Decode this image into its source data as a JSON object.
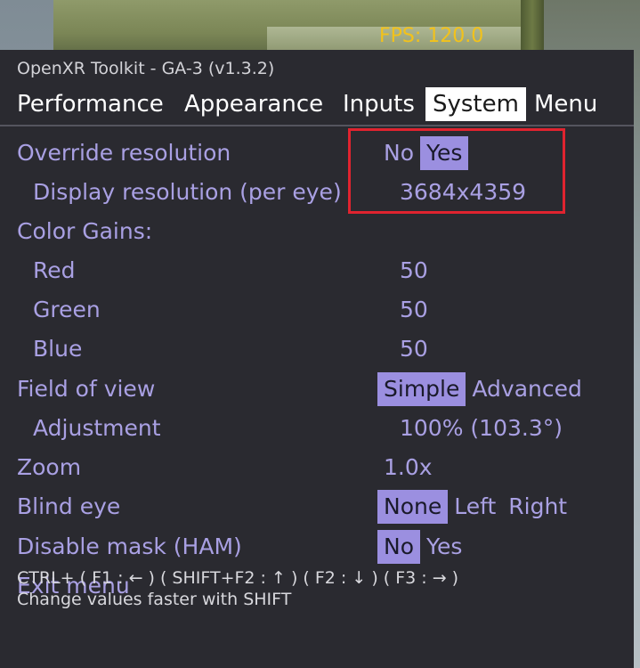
{
  "fps": "FPS: 120.0",
  "panel": {
    "title": "OpenXR Toolkit - GA-3 (v1.3.2)",
    "tabs": [
      "Performance",
      "Appearance",
      "Inputs",
      "System",
      "Menu"
    ],
    "active_tab": "System"
  },
  "settings": {
    "override_resolution": {
      "label": "Override resolution",
      "options": [
        "No",
        "Yes"
      ],
      "selected": "Yes"
    },
    "display_resolution": {
      "label": "Display resolution (per eye)",
      "value": "3684x4359"
    },
    "color_gains": {
      "label": "Color Gains:"
    },
    "red": {
      "label": "Red",
      "value": "50"
    },
    "green": {
      "label": "Green",
      "value": "50"
    },
    "blue": {
      "label": "Blue",
      "value": "50"
    },
    "field_of_view": {
      "label": "Field of view",
      "options": [
        "Simple",
        "Advanced"
      ],
      "selected": "Simple"
    },
    "adjustment": {
      "label": "Adjustment",
      "value": "100% (103.3°)"
    },
    "zoom": {
      "label": "Zoom",
      "value": "1.0x"
    },
    "blind_eye": {
      "label": "Blind eye",
      "options": [
        "None",
        "Left",
        "Right"
      ],
      "selected": "None"
    },
    "disable_mask": {
      "label": "Disable mask (HAM)",
      "options": [
        "No",
        "Yes"
      ],
      "selected": "No"
    },
    "exit_menu": {
      "label": "Exit menu"
    }
  },
  "help": {
    "line1": "CTRL+  ( F1 : ← )  ( SHIFT+F2 : ↑ )  ( F2 : ↓ )  ( F3 : → )",
    "line2": "Change values faster with SHIFT"
  },
  "colors": {
    "accent": "#a9a0e3",
    "selected_bg": "#9b8fe0",
    "highlight_border": "#e0232f",
    "fps": "#f2c21b"
  }
}
